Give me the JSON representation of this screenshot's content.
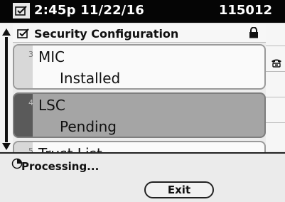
{
  "header": {
    "icon": "settings-checklist-icon",
    "time_date": "2:45p 11/22/16",
    "extension": "115012"
  },
  "menu": {
    "title_icon": "settings-checklist-icon",
    "title": "Security Configuration",
    "locked": true,
    "items": [
      {
        "number": "3",
        "name": "MIC",
        "status": "Installed",
        "selected": false
      },
      {
        "number": "4",
        "name": "LSC",
        "status": "Pending",
        "selected": true
      },
      {
        "number": "5",
        "name": "Trust List",
        "status": "",
        "selected": false
      }
    ]
  },
  "side": {
    "line_icon": "phone-line-icon"
  },
  "status_bar": {
    "icon": "spinner-icon",
    "text": "Processing..."
  },
  "softkeys": {
    "exit_label": "Exit"
  }
}
